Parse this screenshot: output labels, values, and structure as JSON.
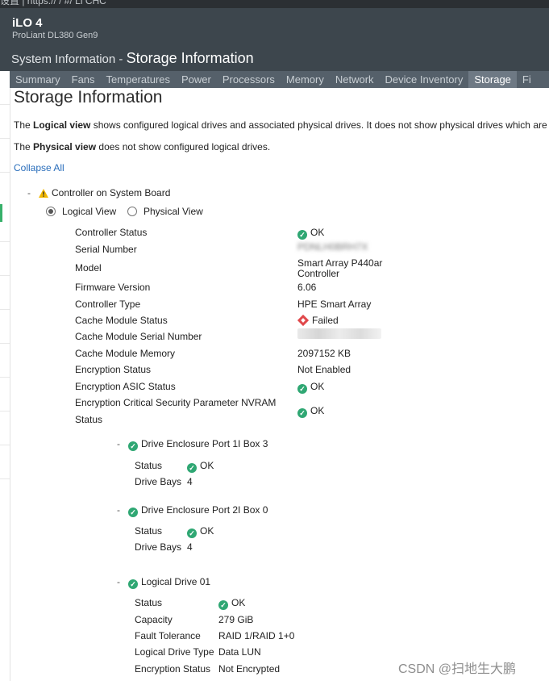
{
  "browser": {
    "url_fragment": "设置 | https://  / #/ Ll CHC"
  },
  "header": {
    "brand": "iLO 4",
    "server_model": "ProLiant DL380 Gen9",
    "breadcrumb_section": "System Information",
    "breadcrumb_sep": " - ",
    "breadcrumb_page": "Storage Information"
  },
  "tabs": [
    {
      "label": "Summary"
    },
    {
      "label": "Fans"
    },
    {
      "label": "Temperatures"
    },
    {
      "label": "Power"
    },
    {
      "label": "Processors"
    },
    {
      "label": "Memory"
    },
    {
      "label": "Network"
    },
    {
      "label": "Device Inventory"
    },
    {
      "label": "Storage",
      "active": true
    },
    {
      "label": "Fi"
    }
  ],
  "page": {
    "title": "Storage Information",
    "desc1_pre": "The ",
    "desc1_bold": "Logical view",
    "desc1_post": " shows configured logical drives and associated physical drives. It does not show physical drives which are not c",
    "desc2_pre": "The ",
    "desc2_bold": "Physical view",
    "desc2_post": " does not show configured logical drives.",
    "collapse_all": "Collapse All"
  },
  "controller": {
    "expander": "-",
    "title": "Controller on System Board",
    "status_icon": "warning-icon",
    "views": [
      {
        "label": "Logical View",
        "selected": true
      },
      {
        "label": "Physical View",
        "selected": false
      }
    ],
    "fields": [
      {
        "label": "Controller Status",
        "value": "OK",
        "icon": "ok-icon"
      },
      {
        "label": "Serial Number",
        "value": "PDNLH0BRH7X",
        "redacted": true
      },
      {
        "label": "Model",
        "value": "Smart Array P440ar",
        "value2": "Controller"
      },
      {
        "label": "Firmware Version",
        "value": "6.06"
      },
      {
        "label": "Controller Type",
        "value": "HPE Smart Array"
      },
      {
        "label": "Cache Module Status",
        "value": "Failed",
        "icon": "failed-icon"
      },
      {
        "label": "Cache Module Serial Number",
        "value": "",
        "redacted": true
      },
      {
        "label": "Cache Module Memory",
        "value": "2097152 KB"
      },
      {
        "label": "Encryption Status",
        "value": "Not Enabled"
      },
      {
        "label": "Encryption ASIC Status",
        "value": "OK",
        "icon": "ok-icon"
      },
      {
        "label": "Encryption Critical Security Parameter NVRAM",
        "label2": "Status",
        "value": "OK",
        "icon": "ok-icon"
      }
    ]
  },
  "enclosures": [
    {
      "expander": "-",
      "title": "Drive Enclosure Port 1I Box 3",
      "fields": [
        {
          "label": "Status",
          "value": "OK",
          "icon": "ok-icon"
        },
        {
          "label": "Drive Bays",
          "value": "4"
        }
      ]
    },
    {
      "expander": "-",
      "title": "Drive Enclosure Port 2I Box 0",
      "fields": [
        {
          "label": "Status",
          "value": "OK",
          "icon": "ok-icon"
        },
        {
          "label": "Drive Bays",
          "value": "4"
        }
      ]
    }
  ],
  "logical_drive": {
    "expander": "-",
    "title": "Logical Drive 01",
    "fields": [
      {
        "label": "Status",
        "value": "OK",
        "icon": "ok-icon"
      },
      {
        "label": "Capacity",
        "value": "279 GiB"
      },
      {
        "label": "Fault Tolerance",
        "value": "RAID 1/RAID 1+0"
      },
      {
        "label": "Logical Drive Type",
        "value": "Data LUN"
      },
      {
        "label": "Encryption Status",
        "value": "Not Encrypted"
      }
    ]
  },
  "watermark": "CSDN @扫地生大鹏"
}
